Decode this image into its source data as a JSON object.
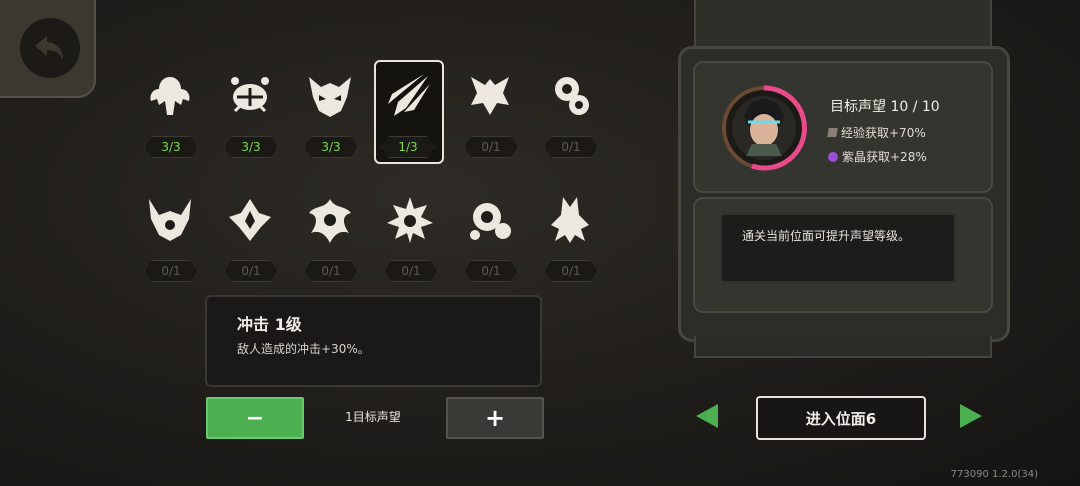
{
  "skills": [
    {
      "name": "skill-1",
      "counter": "3/3",
      "state": "full"
    },
    {
      "name": "skill-2",
      "counter": "3/3",
      "state": "full"
    },
    {
      "name": "skill-3",
      "counter": "3/3",
      "state": "full"
    },
    {
      "name": "skill-4",
      "counter": "1/3",
      "state": "partial"
    },
    {
      "name": "skill-5",
      "counter": "0/1",
      "state": "empty"
    },
    {
      "name": "skill-6",
      "counter": "0/1",
      "state": "empty"
    },
    {
      "name": "skill-7",
      "counter": "0/1",
      "state": "empty"
    },
    {
      "name": "skill-8",
      "counter": "0/1",
      "state": "empty"
    },
    {
      "name": "skill-9",
      "counter": "0/1",
      "state": "empty"
    },
    {
      "name": "skill-10",
      "counter": "0/1",
      "state": "empty"
    },
    {
      "name": "skill-11",
      "counter": "0/1",
      "state": "empty"
    },
    {
      "name": "skill-12",
      "counter": "0/1",
      "state": "empty"
    }
  ],
  "detail": {
    "title": "冲击 1级",
    "text": "敌人造成的冲击+30%。"
  },
  "controls": {
    "minus": "−",
    "plus": "+",
    "label": "1目标声望"
  },
  "reputation": {
    "title": "目标声望 10 / 10",
    "exp": "经验获取+70%",
    "crystal": "紫晶获取+28%",
    "note": "通关当前位面可提升声望等级。"
  },
  "enter_button": "进入位面6",
  "version": "773090 1.2.0(34)",
  "colors": {
    "accent_green": "#4caf50",
    "ring_pink": "#e84a8a",
    "crystal_purple": "#9b4fd8"
  }
}
